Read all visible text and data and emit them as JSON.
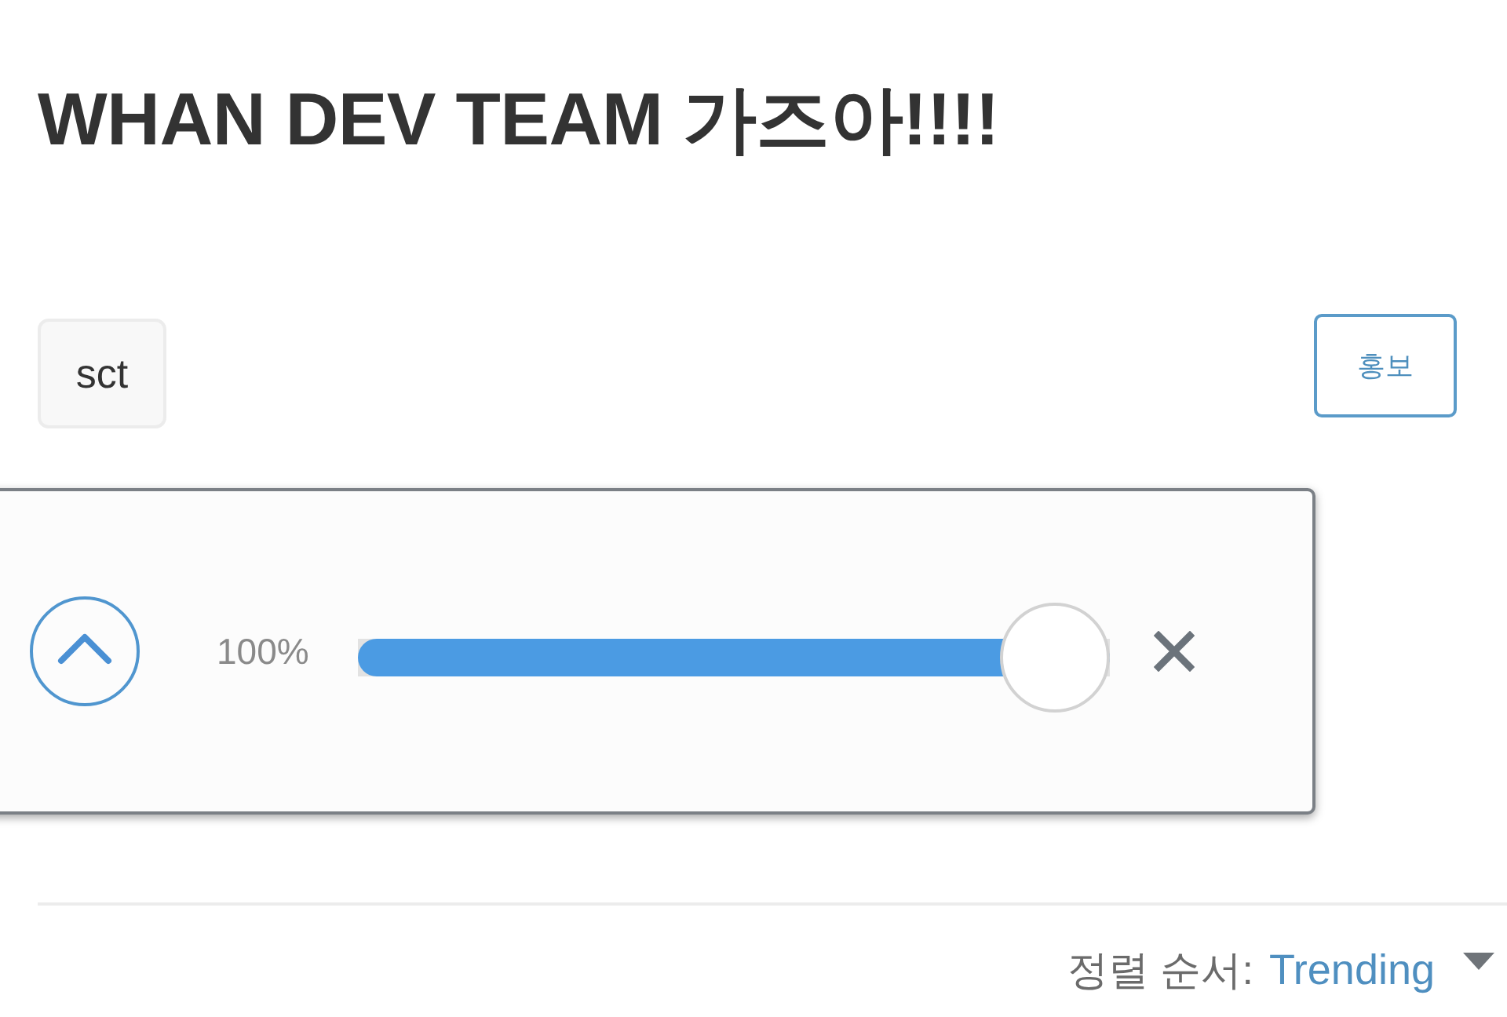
{
  "title": "WHAN DEV TEAM 가즈아!!!!",
  "tags": [
    {
      "label": "sct"
    }
  ],
  "promote_button": {
    "label": "홍보"
  },
  "zoom_panel": {
    "reading": "100%",
    "level": 1
  },
  "sort": {
    "label": "정렬 순서:",
    "value": "Trending"
  }
}
